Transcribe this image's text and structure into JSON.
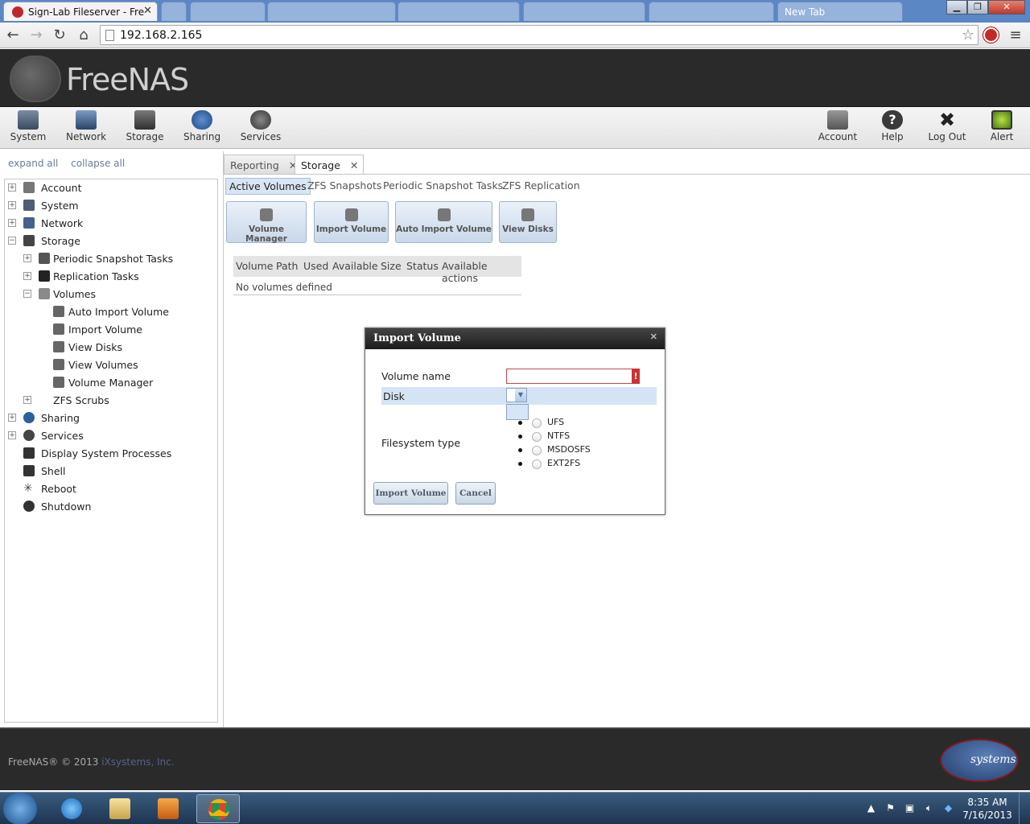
{
  "browser": {
    "active_tab_title": "Sign-Lab Fileserver - FreeN",
    "background_tabs": [
      "",
      "",
      "",
      "",
      "",
      "",
      "New Tab"
    ],
    "url": "192.168.2.165"
  },
  "app": {
    "logo_text": "FreeNAS",
    "nav_left": [
      "System",
      "Network",
      "Storage",
      "Sharing",
      "Services"
    ],
    "nav_right": [
      "Account",
      "Help",
      "Log Out",
      "Alert"
    ]
  },
  "tree": {
    "expand_all": "expand all",
    "collapse_all": "collapse all",
    "nodes": [
      {
        "label": "Account",
        "pm": "+"
      },
      {
        "label": "System",
        "pm": "+"
      },
      {
        "label": "Network",
        "pm": "+"
      },
      {
        "label": "Storage",
        "pm": "−"
      },
      {
        "label": "Periodic Snapshot Tasks",
        "pm": "+"
      },
      {
        "label": "Replication Tasks",
        "pm": "+"
      },
      {
        "label": "Volumes",
        "pm": "−"
      },
      {
        "label": "Auto Import Volume",
        "pm": ""
      },
      {
        "label": "Import Volume",
        "pm": ""
      },
      {
        "label": "View Disks",
        "pm": ""
      },
      {
        "label": "View Volumes",
        "pm": ""
      },
      {
        "label": "Volume Manager",
        "pm": ""
      },
      {
        "label": "ZFS Scrubs",
        "pm": "+"
      },
      {
        "label": "Sharing",
        "pm": "+"
      },
      {
        "label": "Services",
        "pm": "+"
      },
      {
        "label": "Display System Processes",
        "pm": ""
      },
      {
        "label": "Shell",
        "pm": ""
      },
      {
        "label": "Reboot",
        "pm": ""
      },
      {
        "label": "Shutdown",
        "pm": ""
      }
    ]
  },
  "main": {
    "tabs": [
      "Reporting",
      "Storage"
    ],
    "subtabs": [
      "Active Volumes",
      "ZFS Snapshots",
      "Periodic Snapshot Tasks",
      "ZFS Replication"
    ],
    "actions": [
      "Volume Manager",
      "Import Volume",
      "Auto Import Volume",
      "View Disks"
    ],
    "columns": [
      "Volume",
      "Path",
      "Used",
      "Available",
      "Size",
      "Status",
      "Available actions"
    ],
    "empty_text": "No volumes defined"
  },
  "dialog": {
    "title": "Import Volume",
    "volume_name_label": "Volume name",
    "volume_name_value": "",
    "error_mark": "!",
    "disk_label": "Disk",
    "fs_label": "Filesystem type",
    "fs_options": [
      "UFS",
      "NTFS",
      "MSDOSFS",
      "EXT2FS"
    ],
    "import_button": "Import Volume",
    "cancel_button": "Cancel"
  },
  "footer": {
    "copyright_prefix": "FreeNAS® © 2013 ",
    "copyright_link": "iXsystems, Inc.",
    "ix_logo_text": "systems"
  },
  "taskbar": {
    "time": "8:35 AM",
    "date": "7/16/2013"
  }
}
